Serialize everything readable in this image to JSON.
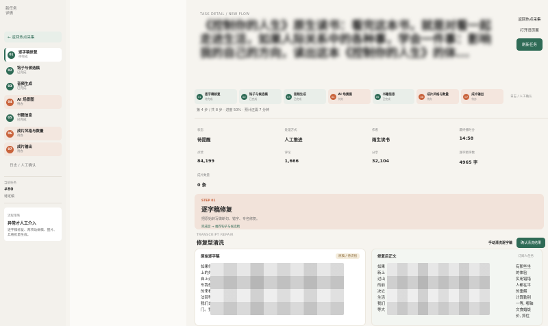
{
  "sidebar": {
    "brand_line1": "新任务",
    "brand_line2": "详情",
    "back_label": "← 返回热点采集",
    "steps": [
      {
        "num": "01",
        "title": "逐字稿修复",
        "status": "待完成",
        "active": true,
        "warm": false,
        "orange": false
      },
      {
        "num": "02",
        "title": "钩子与候选稿",
        "status": "已完成",
        "active": false,
        "warm": false,
        "orange": false
      },
      {
        "num": "03",
        "title": "音频生成",
        "status": "已完成",
        "active": false,
        "warm": false,
        "orange": false
      },
      {
        "num": "04",
        "title": "AI 场景图",
        "status": "待办",
        "active": false,
        "warm": true,
        "orange": true
      },
      {
        "num": "05",
        "title": "书籍信息",
        "status": "已完成",
        "active": false,
        "warm": false,
        "orange": false
      },
      {
        "num": "06",
        "title": "成片风格与数量",
        "status": "待办",
        "active": false,
        "warm": true,
        "orange": true
      },
      {
        "num": "07",
        "title": "成片输出",
        "status": "待办",
        "active": false,
        "warm": true,
        "orange": true
      }
    ],
    "extra_step": "日志 / 人工确认",
    "current_task_label": "当前任务",
    "current_task_id": "#80",
    "current_task_status": "待定稿",
    "flow_label": "流程策略",
    "flow_value": "异常才人工介入",
    "flow_desc": "逐字稿修复、两项动做稿、图片、兵格批量生成。"
  },
  "header": {
    "eyebrow": "TASK DETAIL / NEW FLOW",
    "title": "《控制你的人生》原生读书：看完这本书，就是对看一起走进生活，如果人际关系中的各种事，学会一件事：影响我的自己的方向，读出这本《控制你的人生》的体..."
  },
  "actions": {
    "back_hot": "返回热点采集",
    "open_old": "打开旧页面",
    "refresh": "刷新任务"
  },
  "step_chips": [
    {
      "num": "01",
      "title": "逐字稿修复",
      "status": "待完成",
      "warm": false,
      "orange": false
    },
    {
      "num": "02",
      "title": "钩子与候选稿",
      "status": "已完成",
      "warm": false,
      "orange": false
    },
    {
      "num": "03",
      "title": "音频生成",
      "status": "已完成",
      "warm": false,
      "orange": false
    },
    {
      "num": "04",
      "title": "AI 场景图",
      "status": "待办",
      "warm": true,
      "orange": true
    },
    {
      "num": "05",
      "title": "书籍信息",
      "status": "已完成",
      "warm": false,
      "orange": false
    },
    {
      "num": "06",
      "title": "成片风格与数量",
      "status": "待办",
      "warm": true,
      "orange": true
    },
    {
      "num": "07",
      "title": "成片输出",
      "status": "待办",
      "warm": true,
      "orange": true
    }
  ],
  "step_chip_extra": "日志 / 人工确认",
  "progress_text": "第 4 步 / 共 8 步 · 进度 50% · 预计还需 7 分钟",
  "progress_fraction": 0.5,
  "stats": [
    {
      "label": "状态",
      "value": "待提醒"
    },
    {
      "label": "处理方式",
      "value": "人工推进"
    },
    {
      "label": "作者",
      "value": "雨生读书"
    },
    {
      "label": "最终播时分",
      "value": "14:58"
    },
    {
      "label": "点赞",
      "value": "84,199"
    },
    {
      "label": "评论",
      "value": "1,666"
    },
    {
      "label": "分享",
      "value": "32,104"
    },
    {
      "label": "逐字稿字数",
      "value": "4965 字"
    },
    {
      "label": "成片数量",
      "value": "0 条"
    }
  ],
  "step_card": {
    "kicker": "STEP 01",
    "title": "逐字稿修复",
    "desc": "把原始转写做断句、错字、专名修复。",
    "action": "完成后 → 推荐钩子与候选稿"
  },
  "transcript": {
    "eyebrow": "TRANSCRIPT REPAIR",
    "title": "修复型清洗",
    "btn_manual": "手动清洗逐字稿",
    "btn_confirm": "确认清洗结果",
    "left_title": "原始逐字稿",
    "left_tag": "原稿 / 待识别",
    "right_title": "修复后正文",
    "right_tag": "订阅人任务",
    "left_lines": [
      "如果你",
      "上的外",
      "自上述",
      "车我想",
      "的来看",
      "法回等",
      "我们去",
      "门。我"
    ],
    "right_lines": [
      "如果",
      "新上",
      "过山",
      "的前",
      "决它",
      "生活",
      "我们",
      "等大"
    ],
    "right_end_lines": [
      "有那些坐",
      "的体验",
      "实用错错",
      "人都在平",
      "的重解",
      "计算勤别",
      "一等, 哪轴",
      "文食婚饭",
      "价, 抓住"
    ]
  },
  "colors": {
    "accent": "#2f6b56",
    "warm": "#c9643d",
    "bg": "#f6f4ef"
  }
}
